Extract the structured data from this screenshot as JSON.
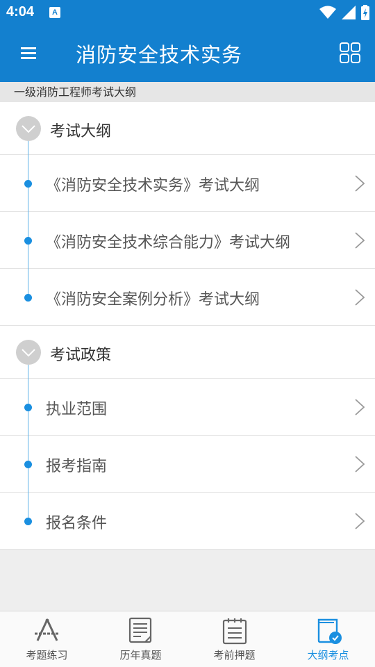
{
  "status_bar": {
    "time": "4:04",
    "notification_icon_letter": "A"
  },
  "app_bar": {
    "title": "消防安全技术实务",
    "menu_icon": "hamburger-menu-icon",
    "grid_icon": "grid-view-icon"
  },
  "subheader": "一级消防工程师考试大纲",
  "sections": [
    {
      "title": "考试大纲",
      "items": [
        {
          "label": "《消防安全技术实务》考试大纲"
        },
        {
          "label": "《消防安全技术综合能力》考试大纲"
        },
        {
          "label": "《消防安全案例分析》考试大纲"
        }
      ]
    },
    {
      "title": "考试政策",
      "items": [
        {
          "label": "执业范围"
        },
        {
          "label": "报考指南"
        },
        {
          "label": "报名条件"
        }
      ]
    }
  ],
  "bottom_nav": [
    {
      "label": "考题练习",
      "icon": "drafting-compass-icon",
      "active": false
    },
    {
      "label": "历年真题",
      "icon": "document-icon",
      "active": false
    },
    {
      "label": "考前押题",
      "icon": "notepad-icon",
      "active": false
    },
    {
      "label": "大纲考点",
      "icon": "book-check-icon",
      "active": true
    }
  ],
  "colors": {
    "primary": "#1380cf",
    "accent": "#1a8fe0",
    "timeline": "#5bb0e8"
  }
}
